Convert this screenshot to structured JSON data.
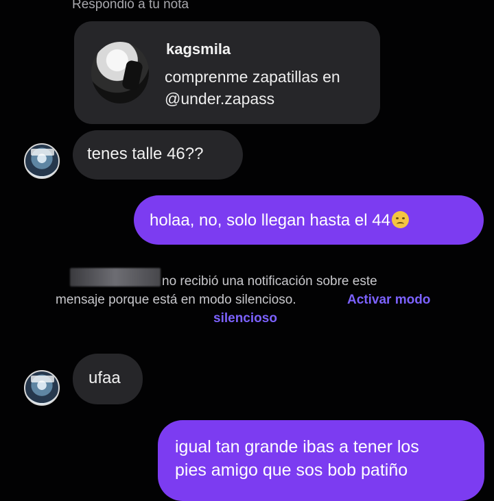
{
  "thread": {
    "reply_label": "Respondió a tu nota",
    "note": {
      "username": "kagsmila",
      "text_lines": [
        "comprenme zapatillas en",
        "@under.zapass"
      ]
    },
    "messages": [
      {
        "from": "them",
        "text": "tenes talle 46??"
      },
      {
        "from": "me",
        "text": "holaa, no, solo llegan hasta el 44",
        "emoji": "disappointed-face"
      },
      {
        "from": "them",
        "text": "ufaa"
      },
      {
        "from": "me",
        "lines": [
          "igual tan grande ibas a tener los",
          "pies amigo que sos bob patiño"
        ]
      }
    ],
    "notice": {
      "line1": "no recibió una notificación sobre este",
      "line2": "mensaje porque está en modo silencioso.",
      "action_line1": "Activar modo",
      "action_line2": "silencioso"
    }
  },
  "colors": {
    "background": "#020203",
    "incoming_bubble": "#262629",
    "outgoing_bubble": "#7c3cf1",
    "action_text": "#7c62ff",
    "notice_text": "#c8c8cc"
  }
}
